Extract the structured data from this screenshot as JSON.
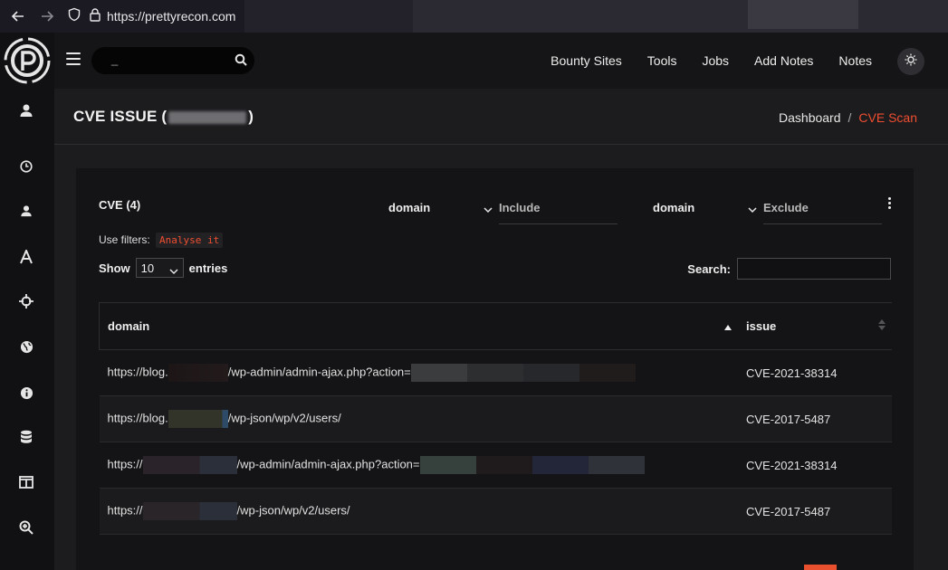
{
  "browser": {
    "url": "https://prettyrecon.com"
  },
  "topnav": {
    "search_placeholder": "_",
    "links": [
      "Bounty Sites",
      "Tools",
      "Jobs",
      "Add Notes",
      "Notes"
    ]
  },
  "page": {
    "title_prefix": "CVE ISSUE (",
    "title_suffix": ")",
    "breadcrumb": {
      "home": "Dashboard",
      "separator": "/",
      "current": "CVE Scan"
    }
  },
  "card": {
    "title": "CVE (4)",
    "include_filter": {
      "field": "domain",
      "placeholder": "Include"
    },
    "exclude_filter": {
      "field": "domain",
      "placeholder": "Exclude"
    },
    "use_filters_label": "Use filters:",
    "analyse_label": "Analyse it",
    "show_label": "Show",
    "entries_value": "10",
    "entries_label": "entries",
    "search_label": "Search:"
  },
  "table": {
    "columns": [
      "domain",
      "issue"
    ],
    "rows": [
      {
        "domain_start": "https://blog.",
        "domain_mid": "/wp-admin/admin-ajax.php?action=",
        "issue": "CVE-2021-38314"
      },
      {
        "domain_start": "https://blog.",
        "domain_mid": "/wp-json/wp/v2/users/",
        "issue": "CVE-2017-5487"
      },
      {
        "domain_start": "https://",
        "domain_mid": "/wp-admin/admin-ajax.php?action=",
        "issue": "CVE-2021-38314"
      },
      {
        "domain_start": "https://",
        "domain_mid": "/wp-json/wp/v2/users/",
        "issue": "CVE-2017-5487"
      }
    ]
  },
  "colors": {
    "accent": "#f04e30"
  }
}
